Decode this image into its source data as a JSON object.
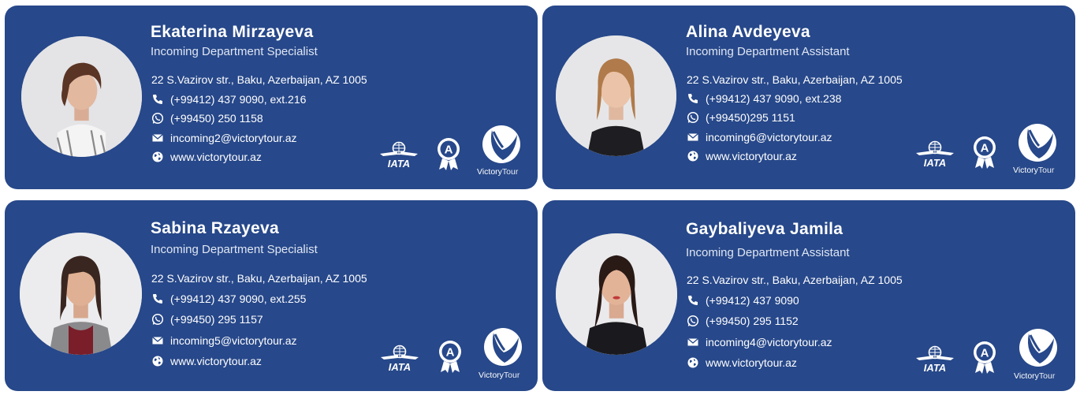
{
  "address": "22 S.Vazirov str., Baku, Azerbaijan, AZ 1005",
  "website": "www.victorytour.az",
  "brand": {
    "name_main": "Victory",
    "name_suffix": "Tour",
    "iata": "IATA",
    "award_letter": "A"
  },
  "colors": {
    "card_bg": "#27488a",
    "text": "#ffffff"
  },
  "cards": [
    {
      "name": "Ekaterina Mirzayeva",
      "title": "Incoming Department Specialist",
      "phone": "(+99412) 437 9090, ext.216",
      "whatsapp": "(+99450) 250 1158",
      "email": "incoming2@victorytour.az"
    },
    {
      "name": "Alina Avdeyeva",
      "title": "Incoming Department Assistant",
      "phone": "(+99412) 437 9090, ext.238",
      "whatsapp": "(+99450)295 1151",
      "email": "incoming6@victorytour.az"
    },
    {
      "name": "Sabina Rzayeva",
      "title": "Incoming Department Specialist",
      "phone": "(+99412) 437 9090, ext.255",
      "whatsapp": "(+99450) 295 1157",
      "email": "incoming5@victorytour.az"
    },
    {
      "name": "Gaybaliyeva Jamila",
      "title": "Incoming Department Assistant",
      "phone": "(+99412) 437 9090",
      "whatsapp": "(+99450) 295 1152",
      "email": "incoming4@victorytour.az"
    }
  ]
}
